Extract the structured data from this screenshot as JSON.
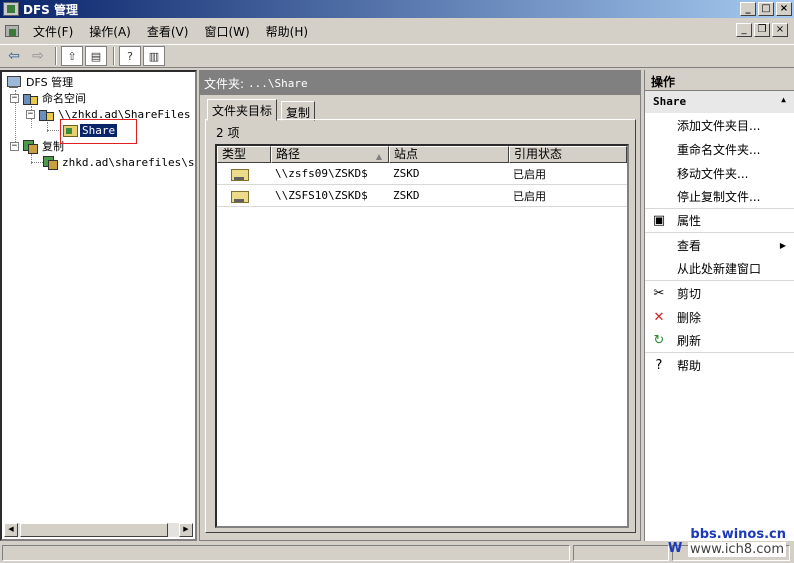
{
  "window": {
    "title": "DFS 管理",
    "controls": {
      "minimize": "_",
      "maximize": "□",
      "close": "×"
    }
  },
  "menubar": {
    "items": [
      "文件(F)",
      "操作(A)",
      "查看(V)",
      "窗口(W)",
      "帮助(H)"
    ],
    "mdi_controls": {
      "minimize": "_",
      "restore": "❐",
      "close": "×"
    }
  },
  "toolbar": {
    "buttons": [
      "back-icon",
      "forward-icon",
      "up-folder-icon",
      "show-hide-tree-icon",
      "properties-help-icon",
      "action-pane-icon"
    ]
  },
  "tree": {
    "root": "DFS 管理",
    "namespaces": "命名空间",
    "namespace_path": "\\\\zhkd.ad\\ShareFiles",
    "share_folder": "Share",
    "replication": "复制",
    "replication_group": "zhkd.ad\\sharefiles\\sha"
  },
  "center": {
    "header_label": "文件夹:",
    "header_path": "...\\Share",
    "tabs": [
      "文件夹目标",
      "复制"
    ],
    "item_count": "2 项",
    "columns": [
      "类型",
      "路径",
      "站点",
      "引用状态"
    ],
    "rows": [
      {
        "path": "\\\\zsfs09\\ZSKD$",
        "site": "ZSKD",
        "status": "已启用"
      },
      {
        "path": "\\\\ZSFS10\\ZSKD$",
        "site": "ZSKD",
        "status": "已启用"
      }
    ]
  },
  "actions": {
    "title": "操作",
    "group": "Share",
    "items": [
      {
        "label": "添加文件夹目...",
        "icon": ""
      },
      {
        "label": "重命名文件夹...",
        "icon": ""
      },
      {
        "label": "移动文件夹...",
        "icon": ""
      },
      {
        "label": "停止复制文件...",
        "icon": ""
      },
      {
        "label": "属性",
        "icon": "properties-icon"
      },
      {
        "label": "查看",
        "icon": ""
      },
      {
        "label": "从此处新建窗口",
        "icon": ""
      },
      {
        "label": "剪切",
        "icon": "cut-icon"
      },
      {
        "label": "删除",
        "icon": "delete-icon"
      },
      {
        "label": "刷新",
        "icon": "refresh-icon"
      },
      {
        "label": "帮助",
        "icon": "help-icon"
      }
    ]
  },
  "watermark": {
    "line1": "bbs.winos.cn",
    "line2": "www.ich8.com",
    "letter": "W"
  }
}
